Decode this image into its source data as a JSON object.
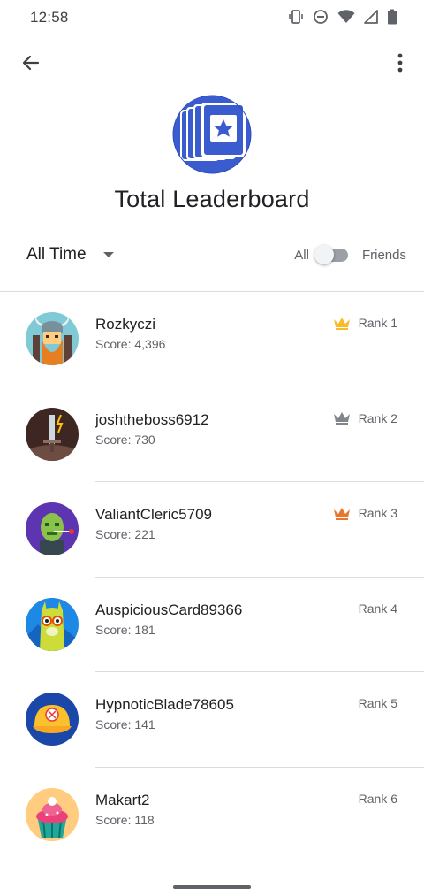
{
  "status_bar": {
    "time": "12:58",
    "icons": [
      "vibrate-icon",
      "do-not-disturb-icon",
      "wifi-icon",
      "signal-icon",
      "battery-icon"
    ]
  },
  "app_bar": {
    "back_icon": "arrow-back-icon",
    "menu_icon": "more-vert-icon"
  },
  "header": {
    "icon": "leaderboard-star-icon",
    "title": "Total Leaderboard"
  },
  "filters": {
    "time_range": "All Time",
    "toggle_left": "All",
    "toggle_right": "Friends",
    "friends_only": false
  },
  "colors": {
    "gold": "#f9bb2b",
    "silver": "#80868b",
    "bronze": "#e8772e",
    "primary_blue": "#3a5ccf"
  },
  "leaderboard": [
    {
      "name": "Rozkyczi",
      "score": "Score: 4,396",
      "rank": "Rank 1",
      "crown": "gold",
      "avatar": "viking-avatar"
    },
    {
      "name": "joshtheboss6912",
      "score": "Score: 730",
      "rank": "Rank 2",
      "crown": "silver",
      "avatar": "sword-avatar"
    },
    {
      "name": "ValiantCleric5709",
      "score": "Score: 221",
      "rank": "Rank 3",
      "crown": "bronze",
      "avatar": "zombie-avatar"
    },
    {
      "name": "AuspiciousCard89366",
      "score": "Score: 181",
      "rank": "Rank 4",
      "crown": null,
      "avatar": "llama-avatar"
    },
    {
      "name": "HypnoticBlade78605",
      "score": "Score: 141",
      "rank": "Rank 5",
      "crown": null,
      "avatar": "baseball-cap-avatar"
    },
    {
      "name": "Makart2",
      "score": "Score: 118",
      "rank": "Rank 6",
      "crown": null,
      "avatar": "cupcake-avatar"
    }
  ]
}
